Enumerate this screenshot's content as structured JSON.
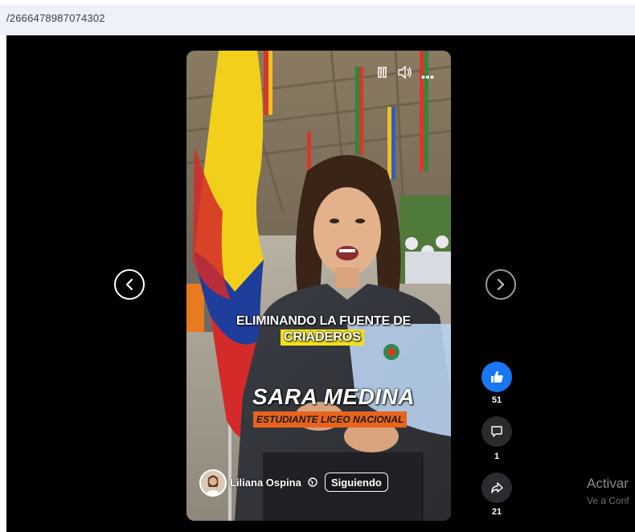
{
  "browser": {
    "url_fragment": "/2666478987074302"
  },
  "video": {
    "caption_line1": "ELIMINANDO LA FUENTE DE",
    "caption_line2": "CRIADEROS",
    "name_title": "SARA MEDINA",
    "name_subtitle": "ESTUDIANTE LICEO NACIONAL",
    "author": "Liliana Ospina",
    "follow_label": "Siguiendo",
    "controls": {
      "pause_icon": "pause-icon",
      "volume_icon": "volume-icon",
      "more_icon": "more-icon"
    }
  },
  "reactions": {
    "like_count": "51",
    "comment_count": "1",
    "share_count": "21"
  },
  "watermark": {
    "title": "Activar",
    "subtitle": "Ve a Conf"
  },
  "colors": {
    "like_blue": "#1877f2",
    "caption_yellow": "#f2e21a",
    "subtitle_orange": "#e8641c"
  }
}
